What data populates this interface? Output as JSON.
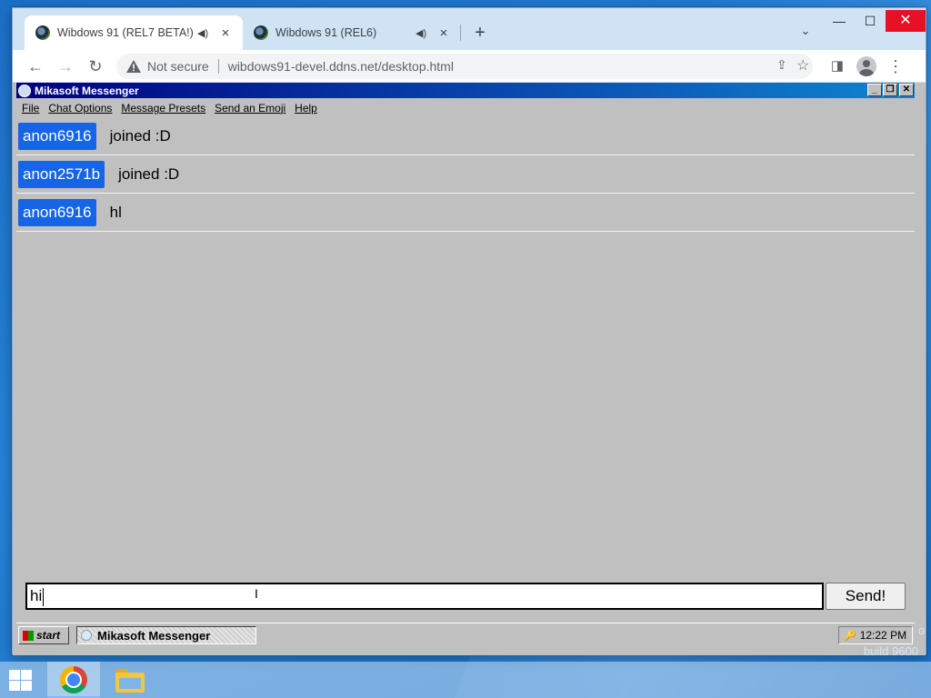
{
  "browser": {
    "tabs": [
      {
        "title": "Wibdows 91 (REL7 BETA!)",
        "active": true,
        "audio_icon": "speaker-icon",
        "close": "×"
      },
      {
        "title": "Wibdows 91 (REL6)",
        "active": false,
        "audio_icon": "speaker-icon",
        "close": "×"
      }
    ],
    "new_tab": "+",
    "tab_search": "⌄",
    "window_controls": {
      "minimize": "—",
      "maximize": "☐",
      "close": "✕"
    },
    "nav": {
      "back": "←",
      "forward": "→",
      "reload": "↻"
    },
    "security_label": "Not secure",
    "url": "wibdows91-devel.ddns.net/desktop.html",
    "share": "⇪",
    "bookmark": "☆",
    "side_panel": "◨",
    "menu": "⋮"
  },
  "messenger": {
    "title": "Mikasoft Messenger",
    "window_controls": {
      "minimize": "_",
      "restore": "❐",
      "close": "✕"
    },
    "menu": [
      "File",
      "Chat Options",
      "Message Presets",
      "Send an Emoji",
      "Help"
    ],
    "messages": [
      {
        "user": "anon6916",
        "text": "joined :D"
      },
      {
        "user": "anon2571b",
        "text": "joined :D"
      },
      {
        "user": "anon6916",
        "text": "hl"
      }
    ],
    "input_value": "hi",
    "send_label": "Send!",
    "user_badge_color": "#1565e6"
  },
  "wibdows_taskbar": {
    "start_label": "start",
    "task_label": "Mikasoft Messenger",
    "clock": "12:22 PM"
  },
  "desktop": {
    "build_text": "build 9600",
    "side_text": "o",
    "taskbar_icons": [
      "windows-start-icon",
      "chrome-icon",
      "file-explorer-icon"
    ]
  }
}
